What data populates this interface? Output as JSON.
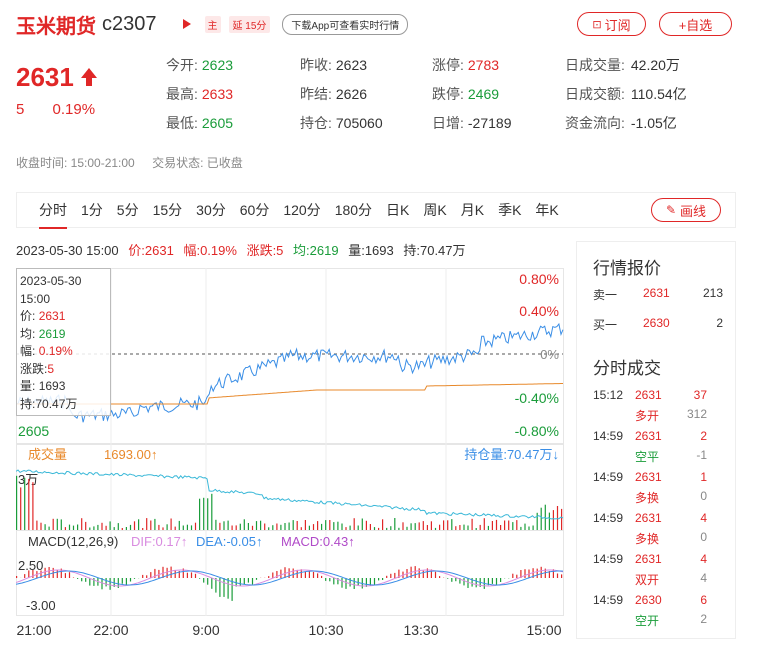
{
  "header": {
    "title": "玉米期货",
    "code": "c2307",
    "tag_main": "主",
    "tag_delay": "延 15分",
    "app_prompt": "下载App可查看实时行情",
    "subscribe": "订阅",
    "add_watch": "+自选"
  },
  "quote": {
    "price": "2631",
    "change": "5",
    "change_pct": "0.19%"
  },
  "stats": [
    {
      "label": "今开:",
      "value": "2623",
      "color": "green"
    },
    {
      "label": "最高:",
      "value": "2633",
      "color": "red"
    },
    {
      "label": "最低:",
      "value": "2605",
      "color": "green"
    },
    {
      "label": "昨收:",
      "value": "2623",
      "color": "plain"
    },
    {
      "label": "昨结:",
      "value": "2626",
      "color": "plain"
    },
    {
      "label": "持仓:",
      "value": "705060",
      "color": "plain"
    },
    {
      "label": "涨停:",
      "value": "2783",
      "color": "red"
    },
    {
      "label": "跌停:",
      "value": "2469",
      "color": "green"
    },
    {
      "label": "日增:",
      "value": "-27189",
      "color": "plain"
    },
    {
      "label": "日成交量:",
      "value": "42.20万",
      "color": "plain"
    },
    {
      "label": "日成交额:",
      "value": "110.54亿",
      "color": "plain"
    },
    {
      "label": "资金流向:",
      "value": "-1.05亿",
      "color": "plain"
    }
  ],
  "status": {
    "close_time": "收盘时间:  15:00-21:00",
    "trade_status": "交易状态:  已收盘"
  },
  "tabs": [
    "分时",
    "1分",
    "5分",
    "15分",
    "30分",
    "60分",
    "120分",
    "180分",
    "日K",
    "周K",
    "月K",
    "季K",
    "年K"
  ],
  "draw_line": "画线",
  "info_bar": {
    "time": "2023-05-30 15:00",
    "price": "价:2631",
    "amp": "幅:0.19%",
    "rise": "涨跌:5",
    "avg": "均:2619",
    "vol": "量:1693",
    "hold": "持:70.47万"
  },
  "tooltip": {
    "date": "2023-05-30",
    "time": "15:00",
    "price_l": "价:",
    "price": "2631",
    "avg_l": "均:",
    "avg": "2619",
    "amp_l": "幅:",
    "amp": "0.19%",
    "rise_l": "涨跌:",
    "rise": "5",
    "vol_l": "量:",
    "vol": "1693",
    "hold_l": "持:",
    "hold": "70.47万"
  },
  "chart_labels": {
    "pct_top": "0.80%",
    "pct_2": "0.40%",
    "pct_mid": "0%",
    "pct_3": "-0.40%",
    "pct_bot": "-0.80%",
    "price_low": "2605",
    "vol_label": "成交量",
    "vol_value": "1693.00↑",
    "hold_label": "持仓量:70.47万↓",
    "vol_axis": "3万",
    "macd": "MACD(12,26,9)",
    "dif": "DIF:0.17↑",
    "dea": "DEA:-0.05↑",
    "macd_val": "MACD:0.43↑",
    "macd_top": "2.50",
    "macd_bot": "-3.00",
    "x_ticks": [
      "21:00",
      "22:00",
      "9:00",
      "10:30",
      "13:30",
      "15:00"
    ]
  },
  "panel": {
    "quote_title": "行情报价",
    "sell": {
      "label": "卖一",
      "price": "2631",
      "vol": "213"
    },
    "buy": {
      "label": "买一",
      "price": "2630",
      "vol": "2"
    },
    "trade_title": "分时成交",
    "trades": [
      {
        "time": "15:12",
        "price": "2631",
        "vol": "37",
        "type": "多开",
        "hold": "312"
      },
      {
        "time": "14:59",
        "price": "2631",
        "vol": "2",
        "type": "空平",
        "hold": "-1"
      },
      {
        "time": "14:59",
        "price": "2631",
        "vol": "1",
        "type": "多换",
        "hold": "0"
      },
      {
        "time": "14:59",
        "price": "2631",
        "vol": "4",
        "type": "多换",
        "hold": "0"
      },
      {
        "time": "14:59",
        "price": "2631",
        "vol": "4",
        "type": "双开",
        "hold": "4"
      },
      {
        "time": "14:59",
        "price": "2630",
        "vol": "6",
        "type": "空开",
        "hold": "2"
      }
    ]
  }
}
